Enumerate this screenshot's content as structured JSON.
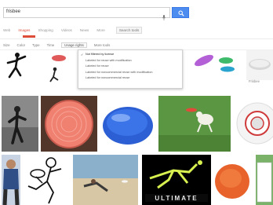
{
  "search": {
    "query": "frisbee"
  },
  "tabs": [
    {
      "label": "Web"
    },
    {
      "label": "Images"
    },
    {
      "label": "Shopping"
    },
    {
      "label": "Videos"
    },
    {
      "label": "News"
    },
    {
      "label": "More"
    },
    {
      "label": "Search tools"
    }
  ],
  "filters": [
    {
      "label": "Size"
    },
    {
      "label": "Color"
    },
    {
      "label": "Type"
    },
    {
      "label": "Time"
    },
    {
      "label": "Usage rights"
    },
    {
      "label": "More tools"
    }
  ],
  "usage_menu": {
    "items": [
      {
        "label": "Not filtered by license",
        "selected": true
      },
      {
        "label": "Labeled for reuse with modification",
        "selected": false
      },
      {
        "label": "Labeled for reuse",
        "selected": false
      },
      {
        "label": "Labeled for noncommercial reuse with modification",
        "selected": false
      },
      {
        "label": "Labeled for noncommercial reuse",
        "selected": false
      }
    ],
    "check_glyph": "✓"
  },
  "captions": {
    "right_tile": "Frisbee"
  },
  "colors": {
    "accent_red": "#dd4b39",
    "search_blue": "#4d8df0"
  }
}
